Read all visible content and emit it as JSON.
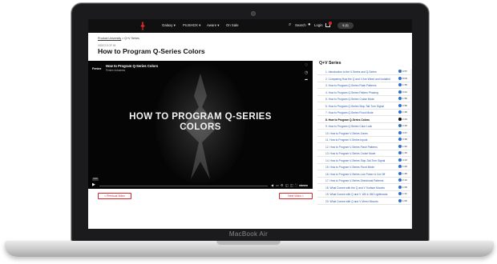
{
  "device": {
    "model_label": "MacBook Air"
  },
  "topnav": {
    "items": [
      "Galaxy",
      "ProSHOX",
      "Aware",
      "On Sale"
    ],
    "search_label": "Search",
    "login_label": "Login",
    "currency_label": "$ ($)"
  },
  "breadcrumb": {
    "parent": "Product University",
    "separator": " > ",
    "current": "Q+V Series"
  },
  "page": {
    "video_count": "VIDEO 8 OF 49",
    "title": "How to Program Q-Series Colors"
  },
  "player": {
    "brand": "Feniex",
    "title": "How to Program Q-Series Colors",
    "subtitle": "Feniex Industries",
    "big_title_line1": "HOW TO PROGRAM Q-SERIES",
    "big_title_line2": "COLORS",
    "time": "0:00",
    "progress": 0,
    "vimeo_label": "vimeo"
  },
  "buttons": {
    "previous": "< Previous Video",
    "next": "Next Video >"
  },
  "playlist": {
    "title": "Q+V Series",
    "active_index": 7,
    "items": [
      {
        "label": "1.  Introduction to the V-Series and Q-Series",
        "duration": "3:57"
      },
      {
        "label": "2.  Comparing How the Q and V Are Wired and Installed",
        "duration": "8:03"
      },
      {
        "label": "3.  How to Program Q-Series Flash Patterns",
        "duration": "1:35"
      },
      {
        "label": "4.  How to Program Q-Series Pattern Phasing",
        "duration": "3:41"
      },
      {
        "label": "5.  How to Program Q-Series Cruise Mode",
        "duration": "1:56"
      },
      {
        "label": "6.  How to Program Q-Series Stop-Tail-Turn Signal",
        "duration": "2:55"
      },
      {
        "label": "7.  How to Program Q-Series Flood Mode",
        "duration": "1:25"
      },
      {
        "label": "8.  How to Program Q-Series Colors",
        "duration": "2:34"
      },
      {
        "label": "9.  How to Program Q-Series Color Lock",
        "duration": "2:15"
      },
      {
        "label": "10.  How to Program V-Series Zones",
        "duration": "3:47"
      },
      {
        "label": "11.  How to Program V-Series Inputs",
        "duration": "3:35"
      },
      {
        "label": "12.  How to Program V-Series Flash Patterns",
        "duration": "1:42"
      },
      {
        "label": "13.  How to Program V-Series Cruise Mode",
        "duration": "1:15"
      },
      {
        "label": "14.  How to Program V-Series Stop-Tail-Turn Signal",
        "duration": "4:13"
      },
      {
        "label": "15.  How to Program V-Series Flood Mode",
        "duration": "1:23"
      },
      {
        "label": "16.  How to Program V-Series Low Power & Cut Off",
        "duration": "1:36"
      },
      {
        "label": "17.  How to Program V-Series Directional Patterns",
        "duration": "2:12"
      },
      {
        "label": "18.  What Comes with the Q and V Surface Mounts",
        "duration": "1:06"
      },
      {
        "label": "19.  What Comes with Q and V 180 & 360 Lightheads",
        "duration": "1:11"
      },
      {
        "label": "20.  What Comes with Q and V Mirror Mounts",
        "duration": "1:00"
      }
    ]
  },
  "colors": {
    "accent": "#d9262c",
    "link": "#2b5aa8",
    "duration_dot": "#2b6fd6",
    "nav_bg": "#101010"
  },
  "icons": [
    "brand-logo-icon",
    "search-icon",
    "user-icon",
    "cart-icon",
    "heart-icon",
    "clock-icon",
    "share-icon",
    "play-icon",
    "settings-icon",
    "fullscreen-icon"
  ]
}
